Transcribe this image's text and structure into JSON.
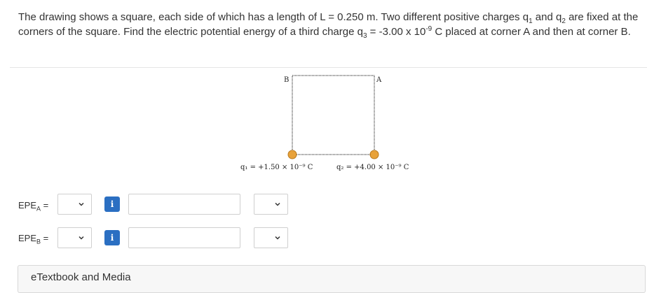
{
  "question": {
    "part1": "The drawing shows a square, each side of which has a length of L = 0.250 m. Two different positive charges q",
    "q1_sub": "1",
    "part2": " and q",
    "q2_sub": "2",
    "part3": " are fixed at the corners of the square. Find the electric potential energy of a third charge q",
    "q3_sub": "3",
    "part4": " = -3.00 x 10",
    "exp": "-9",
    "part5": " C placed at corner A and then at corner B."
  },
  "figure": {
    "label_b": "B",
    "label_a": "A",
    "q1_text": "q₁ = +1.50 × 10⁻⁹ C",
    "q2_text": "q₂ = +4.00 × 10⁻⁹ C",
    "charge_color": "#e8a23a"
  },
  "answers": [
    {
      "label": "EPE",
      "sub": "A",
      "suffix": " =",
      "value": "",
      "info_icon": "i"
    },
    {
      "label": "EPE",
      "sub": "B",
      "suffix": " =",
      "value": "",
      "info_icon": "i"
    }
  ],
  "etextbook_label": "eTextbook and Media",
  "colors": {
    "info_blue": "#2b6fc2",
    "border": "#cfcfcf"
  }
}
